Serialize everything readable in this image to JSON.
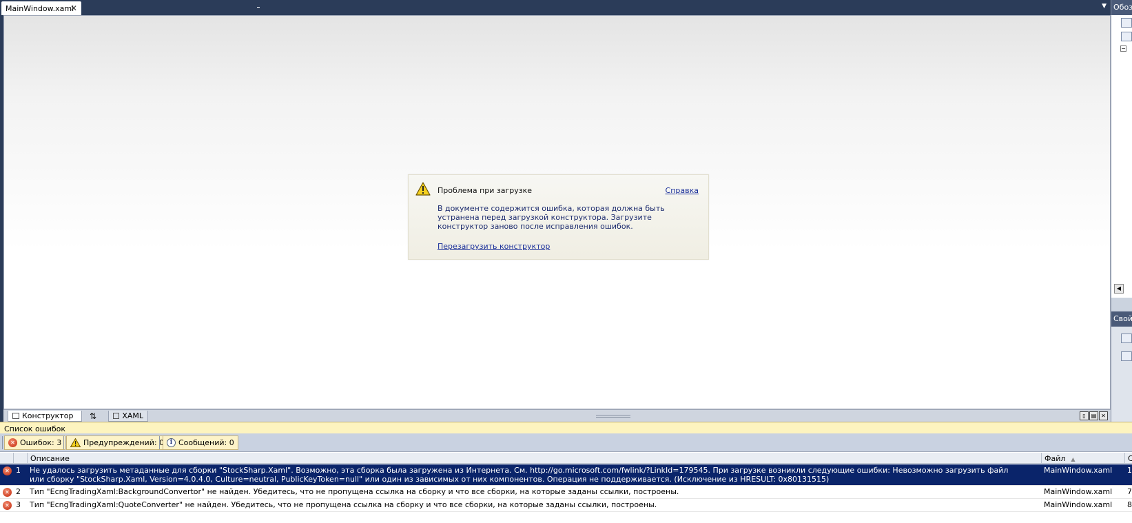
{
  "document": {
    "tab_label": "MainWindow.xaml",
    "close_glyph": "✕",
    "dropdown_glyph": "▼"
  },
  "designer": {
    "error_card": {
      "title": "Проблема при загрузке",
      "help_link": "Справка",
      "message": "В документе содержится ошибка, которая должна быть устранена перед загрузкой конструктора. Загрузите конструктор заново после исправления ошибок.",
      "reload_link": "Перезагрузить конструктор"
    },
    "view_tabs": {
      "designer_label": "Конструктор",
      "swap_glyph": "⇅",
      "xaml_label": "XAML"
    }
  },
  "right_panel": {
    "header_top": "Обозреватель",
    "header_bottom": "Свойства"
  },
  "error_list": {
    "title": "Список ошибок",
    "filters": {
      "errors": "Ошибок: 3",
      "warnings": "Предупреждений: 0",
      "messages": "Сообщений: 0"
    },
    "columns": {
      "description": "Описание",
      "file": "Файл",
      "line": "С"
    },
    "rows": [
      {
        "num": "1",
        "description": "Не удалось загрузить метаданные для сборки \"StockSharp.Xaml\". Возможно, эта сборка была загружена из Интернета. См. http://go.microsoft.com/fwlink/?LinkId=179545. При загрузке возникли следующие ошибки: Невозможно загрузить файл или сборку \"StockSharp.Xaml, Version=4.0.4.0, Culture=neutral, PublicKeyToken=null\" или один из зависимых от них компонентов. Операция не поддерживается. (Исключение из HRESULT: 0x80131515)",
        "file": "MainWindow.xaml",
        "line": "1",
        "selected": true
      },
      {
        "num": "2",
        "description": "Тип \"EcngTradingXaml:BackgroundConvertor\" не найден. Убедитесь, что не пропущена ссылка на сборку и что все сборки, на которые заданы ссылки, построены.",
        "file": "MainWindow.xaml",
        "line": "7"
      },
      {
        "num": "3",
        "description": "Тип \"EcngTradingXaml:QuoteConverter\" не найден. Убедитесь, что не пропущена ссылка на сборку и что все сборки, на которые заданы ссылки, построены.",
        "file": "MainWindow.xaml",
        "line": "8"
      }
    ]
  },
  "colors": {
    "chrome": "#2b3c59",
    "selection": "#0a246a",
    "error_list_title_bg": "#fdf4bf",
    "link": "#1a2f9a"
  }
}
